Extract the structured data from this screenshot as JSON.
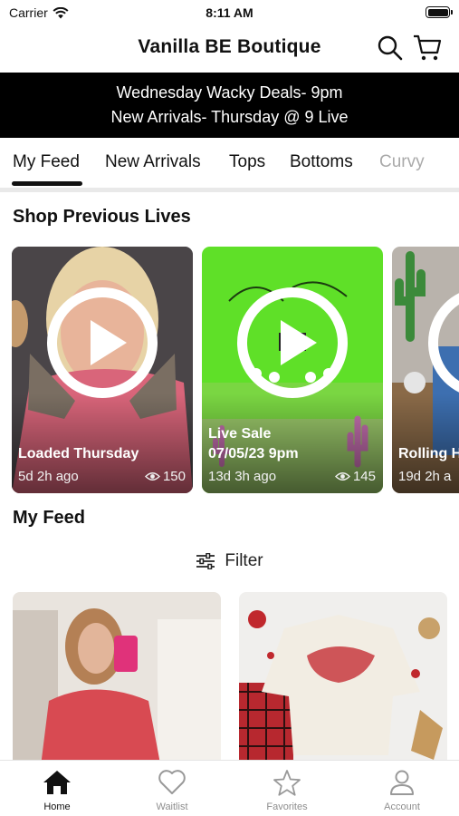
{
  "status_bar": {
    "carrier": "Carrier",
    "time": "8:11 AM"
  },
  "header": {
    "title": "Vanilla BE Boutique"
  },
  "banner": {
    "line1": "Wednesday Wacky Deals- 9pm",
    "line2": "New Arrivals- Thursday @ 9 Live"
  },
  "tabs": [
    {
      "label": "My Feed"
    },
    {
      "label": "New Arrivals"
    },
    {
      "label": "Tops"
    },
    {
      "label": "Bottoms"
    },
    {
      "label": "Curvy"
    }
  ],
  "previous_lives": {
    "title": "Shop Previous Lives",
    "items": [
      {
        "title": "Loaded Thursday",
        "ago": "5d 2h ago",
        "views": "150"
      },
      {
        "title_line1": "Live Sale",
        "title_line2": "07/05/23 9pm",
        "ago": "13d 3h ago",
        "views": "145"
      },
      {
        "title": "Rolling H",
        "ago": "19d 2h a"
      }
    ]
  },
  "feed": {
    "title": "My Feed",
    "filter_label": "Filter"
  },
  "bottom_nav": [
    {
      "label": "Home"
    },
    {
      "label": "Waitlist"
    },
    {
      "label": "Favorites"
    },
    {
      "label": "Account"
    }
  ],
  "colors": {
    "banner_bg": "#000000",
    "live_green": "#5fe028",
    "tab_active": "#111111",
    "tab_inactive": "#8e8e8e"
  }
}
